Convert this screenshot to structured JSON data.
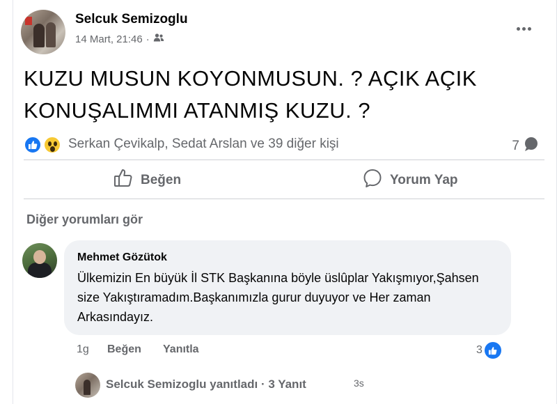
{
  "post": {
    "author": "Selcuk Semizoglu",
    "date": "14 Mart, 21:46",
    "separator": "·",
    "audience_icon": "friends-icon",
    "text": "KUZU MUSUN KOYONMUSUN. ? AÇIK AÇIK KONUŞALIMMI ATANMIŞ KUZU. ?"
  },
  "reactions": {
    "types": [
      "like",
      "wow"
    ],
    "names": "Serkan Çevikalp, Sedat Arslan ve 39 diğer kişi",
    "comment_count": "7"
  },
  "actions": {
    "like_label": "Beğen",
    "comment_label": "Yorum Yap"
  },
  "comments": {
    "see_more": "Diğer yorumları gör",
    "items": [
      {
        "author": "Mehmet Gözütok",
        "text": "Ülkemizin En büyük İl STK Başkanına böyle üslûplar Yakışmıyor,Şahsen size Yakıştıramadım.Başkanımızla gurur duyuyor ve Her zaman Arkasındayız.",
        "time": "1g",
        "like_label": "Beğen",
        "reply_label": "Yanıtla",
        "reaction_count": "3",
        "reply_summary": "Selcuk Semizoglu yanıtladı · 3 Yanıt",
        "reply_time": "3s"
      }
    ]
  },
  "colors": {
    "accent": "#1877f2",
    "secondary_text": "#65676b",
    "bubble_bg": "#f0f2f5"
  }
}
